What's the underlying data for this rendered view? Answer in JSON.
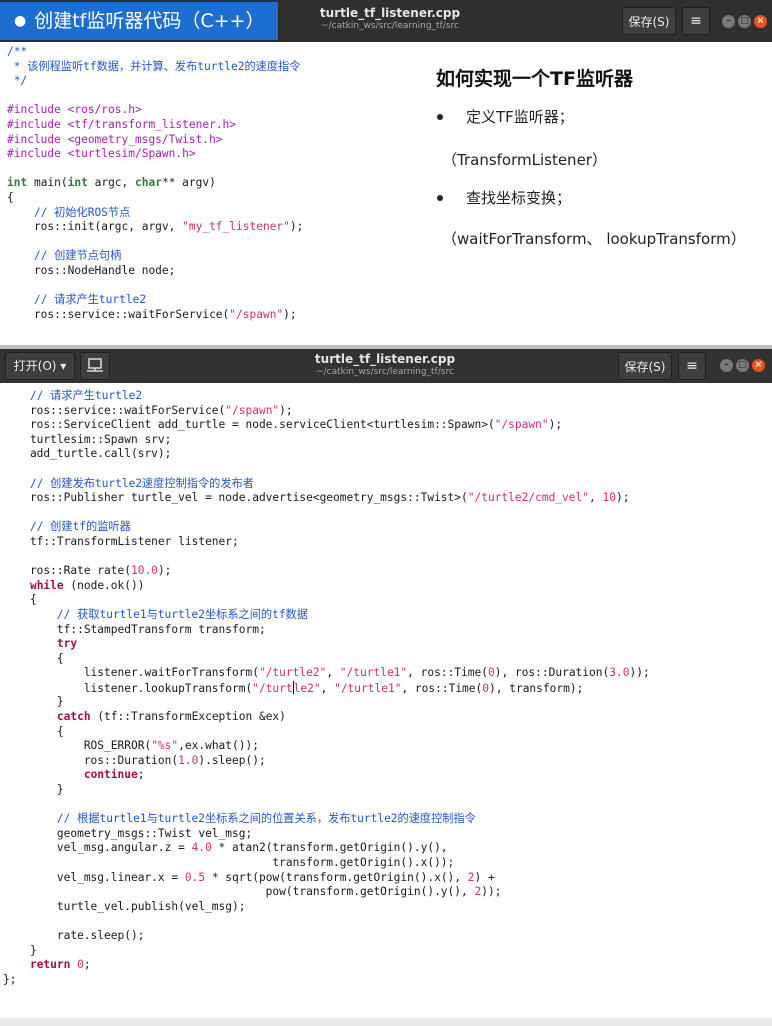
{
  "slide": {
    "title": "创建tf监听器代码（C++）",
    "heading": "如何实现一个TF监听器",
    "bullet1": "定义TF监听器；",
    "bullet1_sub": "（TransformListener）",
    "bullet2": "查找坐标变换；",
    "bullet2_sub": "（waitForTransform、 lookupTransform）"
  },
  "editor1": {
    "filename": "turtle_tf_listener.cpp",
    "path": "~/catkin_ws/src/learning_tf/src",
    "save_label": "保存(S)"
  },
  "editor2": {
    "open_label": "打开(O) ▾",
    "filename": "turtle_tf_listener.cpp",
    "path": "~/catkin_ws/src/learning_tf/src",
    "save_label": "保存(S)"
  },
  "code1": [
    [
      [
        "cm",
        "/**"
      ]
    ],
    [
      [
        "cm",
        " * 该例程监听tf数据，并计算、发布turtle2的速度指令"
      ]
    ],
    [
      [
        "cm",
        " */"
      ]
    ],
    [
      [
        "",
        ""
      ]
    ],
    [
      [
        "pp",
        "#include <ros/ros.h>"
      ]
    ],
    [
      [
        "pp",
        "#include <tf/transform_listener.h>"
      ]
    ],
    [
      [
        "pp",
        "#include <geometry_msgs/Twist.h>"
      ]
    ],
    [
      [
        "pp",
        "#include <turtlesim/Spawn.h>"
      ]
    ],
    [
      [
        "",
        ""
      ]
    ],
    [
      [
        "ty",
        "int"
      ],
      [
        "",
        " main("
      ],
      [
        "ty",
        "int"
      ],
      [
        "",
        " argc, "
      ],
      [
        "ty",
        "char"
      ],
      [
        "",
        "** argv)"
      ]
    ],
    [
      [
        "",
        "{"
      ]
    ],
    [
      [
        "",
        "    "
      ],
      [
        "cm",
        "// 初始化ROS节点"
      ]
    ],
    [
      [
        "",
        "    ros::init(argc, argv, "
      ],
      [
        "st",
        "\"my_tf_listener\""
      ],
      [
        "",
        ");"
      ]
    ],
    [
      [
        "",
        ""
      ]
    ],
    [
      [
        "",
        "    "
      ],
      [
        "cm",
        "// 创建节点句柄"
      ]
    ],
    [
      [
        "",
        "    ros::NodeHandle node;"
      ]
    ],
    [
      [
        "",
        ""
      ]
    ],
    [
      [
        "",
        "    "
      ],
      [
        "cm",
        "// 请求产生turtle2"
      ]
    ],
    [
      [
        "",
        "    ros::service::waitForService("
      ],
      [
        "st",
        "\"/spawn\""
      ],
      [
        "",
        ");"
      ]
    ]
  ],
  "code2": [
    [
      [
        "",
        "    "
      ],
      [
        "cm",
        "// 请求产生turtle2"
      ]
    ],
    [
      [
        "",
        "    ros::service::waitForService("
      ],
      [
        "st",
        "\"/spawn\""
      ],
      [
        "",
        ");"
      ]
    ],
    [
      [
        "",
        "    ros::ServiceClient add_turtle = node.serviceClient<turtlesim::Spawn>("
      ],
      [
        "st",
        "\"/spawn\""
      ],
      [
        "",
        ");"
      ]
    ],
    [
      [
        "",
        "    turtlesim::Spawn srv;"
      ]
    ],
    [
      [
        "",
        "    add_turtle.call(srv);"
      ]
    ],
    [
      [
        "",
        ""
      ]
    ],
    [
      [
        "",
        "    "
      ],
      [
        "cm",
        "// 创建发布turtle2速度控制指令的发布者"
      ]
    ],
    [
      [
        "",
        "    ros::Publisher turtle_vel = node.advertise<geometry_msgs::Twist>("
      ],
      [
        "st",
        "\"/turtle2/cmd_vel\""
      ],
      [
        "",
        ", "
      ],
      [
        "nu",
        "10"
      ],
      [
        "",
        ");"
      ]
    ],
    [
      [
        "",
        ""
      ]
    ],
    [
      [
        "",
        "    "
      ],
      [
        "cm",
        "// 创建tf的监听器"
      ]
    ],
    [
      [
        "",
        "    tf::TransformListener listener;"
      ]
    ],
    [
      [
        "",
        ""
      ]
    ],
    [
      [
        "",
        "    ros::Rate rate("
      ],
      [
        "nu",
        "10.0"
      ],
      [
        "",
        ");"
      ]
    ],
    [
      [
        "",
        "    "
      ],
      [
        "kw",
        "while"
      ],
      [
        "",
        " (node.ok())"
      ]
    ],
    [
      [
        "",
        "    {"
      ]
    ],
    [
      [
        "",
        "        "
      ],
      [
        "cm",
        "// 获取turtle1与turtle2坐标系之间的tf数据"
      ]
    ],
    [
      [
        "",
        "        tf::StampedTransform transform;"
      ]
    ],
    [
      [
        "",
        "        "
      ],
      [
        "kw",
        "try"
      ]
    ],
    [
      [
        "",
        "        {"
      ]
    ],
    [
      [
        "",
        "            listener.waitForTransform("
      ],
      [
        "st",
        "\"/turtle2\""
      ],
      [
        "",
        ", "
      ],
      [
        "st",
        "\"/turtle1\""
      ],
      [
        "",
        ", ros::Time("
      ],
      [
        "nu",
        "0"
      ],
      [
        "",
        "), ros::Duration("
      ],
      [
        "nu",
        "3.0"
      ],
      [
        "",
        "));"
      ]
    ],
    [
      [
        "",
        "            listener.lookupTransform("
      ],
      [
        "st",
        "\"/turt"
      ],
      [
        "cursor",
        ""
      ],
      [
        "st",
        "le2\""
      ],
      [
        "",
        ", "
      ],
      [
        "st",
        "\"/turtle1\""
      ],
      [
        "",
        ", ros::Time("
      ],
      [
        "nu",
        "0"
      ],
      [
        "",
        "), transform);"
      ]
    ],
    [
      [
        "",
        "        }"
      ]
    ],
    [
      [
        "",
        "        "
      ],
      [
        "kw",
        "catch"
      ],
      [
        "",
        " (tf::TransformException &ex)"
      ]
    ],
    [
      [
        "",
        "        {"
      ]
    ],
    [
      [
        "",
        "            ROS_ERROR("
      ],
      [
        "st",
        "\"%s\""
      ],
      [
        "",
        ",ex.what());"
      ]
    ],
    [
      [
        "",
        "            ros::Duration("
      ],
      [
        "nu",
        "1.0"
      ],
      [
        "",
        ").sleep();"
      ]
    ],
    [
      [
        "",
        "            "
      ],
      [
        "kw",
        "continue"
      ],
      [
        "",
        ";"
      ]
    ],
    [
      [
        "",
        "        }"
      ]
    ],
    [
      [
        "",
        ""
      ]
    ],
    [
      [
        "",
        "        "
      ],
      [
        "cm",
        "// 根据turtle1与turtle2坐标系之间的位置关系，发布turtle2的速度控制指令"
      ]
    ],
    [
      [
        "",
        "        geometry_msgs::Twist vel_msg;"
      ]
    ],
    [
      [
        "",
        "        vel_msg.angular.z = "
      ],
      [
        "nu",
        "4.0"
      ],
      [
        "",
        " * atan2(transform.getOrigin().y(),"
      ]
    ],
    [
      [
        "",
        "                                        transform.getOrigin().x());"
      ]
    ],
    [
      [
        "",
        "        vel_msg.linear.x = "
      ],
      [
        "nu",
        "0.5"
      ],
      [
        "",
        " * sqrt(pow(transform.getOrigin().x(), "
      ],
      [
        "nu",
        "2"
      ],
      [
        "",
        ") +"
      ]
    ],
    [
      [
        "",
        "                                       pow(transform.getOrigin().y(), "
      ],
      [
        "nu",
        "2"
      ],
      [
        "",
        "));"
      ]
    ],
    [
      [
        "",
        "        turtle_vel.publish(vel_msg);"
      ]
    ],
    [
      [
        "",
        ""
      ]
    ],
    [
      [
        "",
        "        rate.sleep();"
      ]
    ],
    [
      [
        "",
        "    }"
      ]
    ],
    [
      [
        "",
        "    "
      ],
      [
        "kw",
        "return"
      ],
      [
        "",
        " "
      ],
      [
        "nu",
        "0"
      ],
      [
        "",
        ";"
      ]
    ],
    [
      [
        "",
        "};"
      ]
    ]
  ]
}
